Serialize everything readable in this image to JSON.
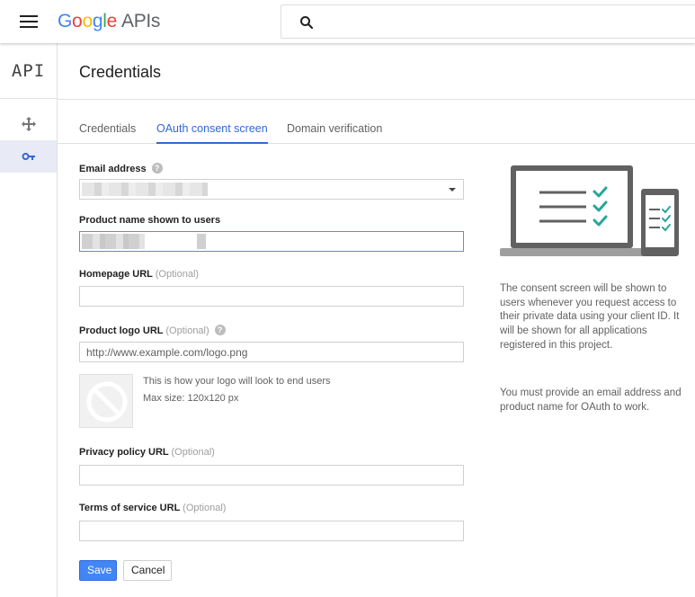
{
  "header": {
    "logo_letters": [
      "G",
      "o",
      "o",
      "g",
      "l",
      "e"
    ],
    "logo_suffix": "APIs",
    "search_placeholder": ""
  },
  "rail": {
    "api_label": "API",
    "items": [
      {
        "icon": "dashboard-arrows-icon",
        "active": false
      },
      {
        "icon": "key-icon",
        "active": true
      }
    ]
  },
  "page": {
    "title": "Credentials"
  },
  "tabs": [
    {
      "label": "Credentials",
      "active": false
    },
    {
      "label": "OAuth consent screen",
      "active": true
    },
    {
      "label": "Domain verification",
      "active": false
    }
  ],
  "form": {
    "email_label": "Email address",
    "product_label": "Product name shown to users",
    "homepage_label": "Homepage URL",
    "optional": "(Optional)",
    "logo_label": "Product logo URL",
    "logo_placeholder": "http://www.example.com/logo.png",
    "logo_note": "This is how your logo will look to end users",
    "logo_size": "Max size: 120x120 px",
    "privacy_label": "Privacy policy URL",
    "terms_label": "Terms of service URL",
    "save_label": "Save",
    "cancel_label": "Cancel"
  },
  "sidebar_info": {
    "text1": "The consent screen will be shown to users whenever you request access to their private data using your client ID. It will be shown for all applications registered in this project.",
    "text2": "You must provide an email address and product name for OAuth to work."
  },
  "colors": {
    "accent": "#3367d6",
    "button": "#4285f4",
    "check": "#26a69a"
  }
}
